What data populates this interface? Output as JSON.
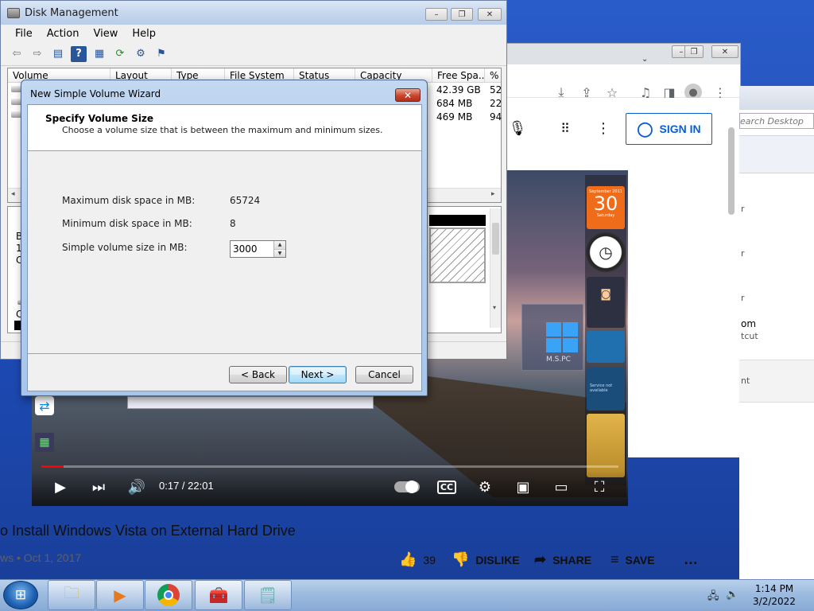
{
  "disk_mgmt": {
    "title": "Disk Management",
    "menu": [
      "File",
      "Action",
      "View",
      "Help"
    ],
    "columns": [
      "Volume",
      "Layout",
      "Type",
      "File System",
      "Status",
      "Capacity",
      "Free Spa...",
      "% F"
    ],
    "rows": [
      {
        "free": "42.39 GB",
        "pct": "52"
      },
      {
        "free": "684 MB",
        "pct": "22"
      },
      {
        "free": "469 MB",
        "pct": "94"
      }
    ],
    "graph_left": [
      "B",
      "1",
      "C"
    ],
    "graph_left2": [
      "C"
    ]
  },
  "wizard": {
    "title": "New Simple Volume Wizard",
    "heading": "Specify Volume Size",
    "subheading": "Choose a volume size that is between the maximum and minimum sizes.",
    "max_label": "Maximum disk space in MB:",
    "max_value": "65724",
    "min_label": "Minimum disk space in MB:",
    "min_value": "8",
    "size_label": "Simple volume size in MB:",
    "size_value": "3000",
    "back": "< Back",
    "next": "Next >",
    "cancel": "Cancel",
    "close_glyph": "✕"
  },
  "youtube": {
    "sign_in": "SIGN IN",
    "time": "0:17 / 22:01",
    "progress_fraction": 0.013,
    "video_title": "o Install Windows Vista on External Hard Drive",
    "meta": "ws • Oct 1, 2017",
    "likes": "39",
    "dislike": "DISLIKE",
    "share": "SHARE",
    "save": "SAVE",
    "more": "…",
    "calendar_month": "September 2011",
    "calendar_day": "30",
    "calendar_weekday": "Saturday",
    "gadget_text": "Service not available",
    "watermark": "M.S.PC"
  },
  "right_panel": {
    "search_placeholder": "earch Desktop",
    "fragments": [
      "r",
      "r",
      "r",
      "om",
      "tcut",
      "nt"
    ]
  },
  "taskbar": {
    "time": "1:14 PM",
    "date": "3/2/2022"
  },
  "colors": {
    "accent": "#065fd4",
    "desktop": "#1c4ab3",
    "progress": "#ff0000"
  }
}
